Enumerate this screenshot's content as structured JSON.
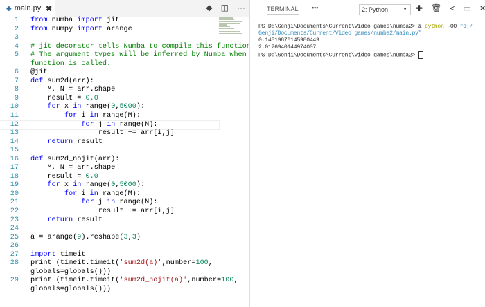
{
  "editor": {
    "tab_label": "main.py",
    "close": "✖",
    "actions": [
      "◆",
      "◫",
      "···"
    ],
    "lines": [
      {
        "n": "1",
        "t": [
          [
            "kw",
            "from"
          ],
          [
            "tx",
            " numba "
          ],
          [
            "kw",
            "import"
          ],
          [
            "tx",
            " jit"
          ]
        ]
      },
      {
        "n": "2",
        "t": [
          [
            "kw",
            "from"
          ],
          [
            "tx",
            " numpy "
          ],
          [
            "kw",
            "import"
          ],
          [
            "tx",
            " arange"
          ]
        ]
      },
      {
        "n": "3",
        "t": []
      },
      {
        "n": "4",
        "t": [
          [
            "cm",
            "# jit decorator tells Numba to compile this function."
          ]
        ]
      },
      {
        "n": "5",
        "t": [
          [
            "cm",
            "# The argument types will be inferred by Numba when"
          ]
        ]
      },
      {
        "n": "",
        "t": [
          [
            "cm",
            "function is called."
          ]
        ]
      },
      {
        "n": "6",
        "t": [
          [
            "tx",
            "@jit"
          ]
        ]
      },
      {
        "n": "7",
        "t": [
          [
            "kw",
            "def"
          ],
          [
            "tx",
            " sum2d(arr):"
          ]
        ]
      },
      {
        "n": "8",
        "t": [
          [
            "tx",
            "    M, N = arr.shape"
          ]
        ]
      },
      {
        "n": "9",
        "t": [
          [
            "tx",
            "    result = "
          ],
          [
            "nm",
            "0.0"
          ]
        ]
      },
      {
        "n": "10",
        "t": [
          [
            "tx",
            "    "
          ],
          [
            "kw",
            "for"
          ],
          [
            "tx",
            " x "
          ],
          [
            "kw",
            "in"
          ],
          [
            "tx",
            " range("
          ],
          [
            "nm",
            "0"
          ],
          [
            "tx",
            ","
          ],
          [
            "nm",
            "5000"
          ],
          [
            "tx",
            "):"
          ]
        ]
      },
      {
        "n": "11",
        "t": [
          [
            "tx",
            "        "
          ],
          [
            "kw",
            "for"
          ],
          [
            "tx",
            " i "
          ],
          [
            "kw",
            "in"
          ],
          [
            "tx",
            " range(M):"
          ]
        ]
      },
      {
        "n": "12",
        "t": [
          [
            "tx",
            "            "
          ],
          [
            "kw",
            "for"
          ],
          [
            "tx",
            " j "
          ],
          [
            "kw",
            "in"
          ],
          [
            "tx",
            " range(N):"
          ]
        ],
        "current": true
      },
      {
        "n": "13",
        "t": [
          [
            "tx",
            "                result += arr[i,j]"
          ]
        ]
      },
      {
        "n": "14",
        "t": [
          [
            "tx",
            "    "
          ],
          [
            "kw",
            "return"
          ],
          [
            "tx",
            " result"
          ]
        ]
      },
      {
        "n": "15",
        "t": []
      },
      {
        "n": "16",
        "t": [
          [
            "kw",
            "def"
          ],
          [
            "tx",
            " sum2d_nojit(arr):"
          ]
        ]
      },
      {
        "n": "17",
        "t": [
          [
            "tx",
            "    M, N = arr.shape"
          ]
        ]
      },
      {
        "n": "18",
        "t": [
          [
            "tx",
            "    result = "
          ],
          [
            "nm",
            "0.0"
          ]
        ]
      },
      {
        "n": "19",
        "t": [
          [
            "tx",
            "    "
          ],
          [
            "kw",
            "for"
          ],
          [
            "tx",
            " x "
          ],
          [
            "kw",
            "in"
          ],
          [
            "tx",
            " range("
          ],
          [
            "nm",
            "0"
          ],
          [
            "tx",
            ","
          ],
          [
            "nm",
            "5000"
          ],
          [
            "tx",
            "):"
          ]
        ]
      },
      {
        "n": "20",
        "t": [
          [
            "tx",
            "        "
          ],
          [
            "kw",
            "for"
          ],
          [
            "tx",
            " i "
          ],
          [
            "kw",
            "in"
          ],
          [
            "tx",
            " range(M):"
          ]
        ]
      },
      {
        "n": "21",
        "t": [
          [
            "tx",
            "            "
          ],
          [
            "kw",
            "for"
          ],
          [
            "tx",
            " j "
          ],
          [
            "kw",
            "in"
          ],
          [
            "tx",
            " range(N):"
          ]
        ]
      },
      {
        "n": "22",
        "t": [
          [
            "tx",
            "                result += arr[i,j]"
          ]
        ]
      },
      {
        "n": "23",
        "t": [
          [
            "tx",
            "    "
          ],
          [
            "kw",
            "return"
          ],
          [
            "tx",
            " result"
          ]
        ]
      },
      {
        "n": "24",
        "t": []
      },
      {
        "n": "25",
        "t": [
          [
            "tx",
            "a = arange("
          ],
          [
            "nm",
            "9"
          ],
          [
            "tx",
            ").reshape("
          ],
          [
            "nm",
            "3"
          ],
          [
            "tx",
            ","
          ],
          [
            "nm",
            "3"
          ],
          [
            "tx",
            ")"
          ]
        ]
      },
      {
        "n": "26",
        "t": []
      },
      {
        "n": "27",
        "t": [
          [
            "kw",
            "import"
          ],
          [
            "tx",
            " timeit"
          ]
        ]
      },
      {
        "n": "28",
        "t": [
          [
            "tx",
            "print (timeit.timeit("
          ],
          [
            "st",
            "'sum2d(a)'"
          ],
          [
            "tx",
            ",number="
          ],
          [
            "nm",
            "100"
          ],
          [
            "tx",
            ","
          ]
        ]
      },
      {
        "n": "",
        "t": [
          [
            "tx",
            "globals=globals()))"
          ]
        ]
      },
      {
        "n": "29",
        "t": [
          [
            "tx",
            "print (timeit.timeit("
          ],
          [
            "st",
            "'sum2d_nojit(a)'"
          ],
          [
            "tx",
            ",number="
          ],
          [
            "nm",
            "100"
          ],
          [
            "tx",
            ","
          ]
        ]
      },
      {
        "n": "",
        "t": [
          [
            "tx",
            "globals=globals()))"
          ]
        ]
      }
    ]
  },
  "terminal": {
    "tab": "TERMINAL",
    "more": "•••",
    "select": "2: Python",
    "actions": [
      "✚",
      "🗑",
      "<",
      "▭",
      "✕"
    ],
    "prompt1": "PS D:\\Genji\\Documents\\Current\\Video games\\numba2> & ",
    "cmd": "python",
    "flag": " -OO ",
    "path1": "\"d:/",
    "path2": "Genji/Documents/Current/Video games/numba2/main.py\"",
    "out1": "0.14519870145980449",
    "out2": "2.0176940144974007",
    "prompt2": "PS D:\\Genji\\Documents\\Current\\Video games\\numba2> "
  }
}
